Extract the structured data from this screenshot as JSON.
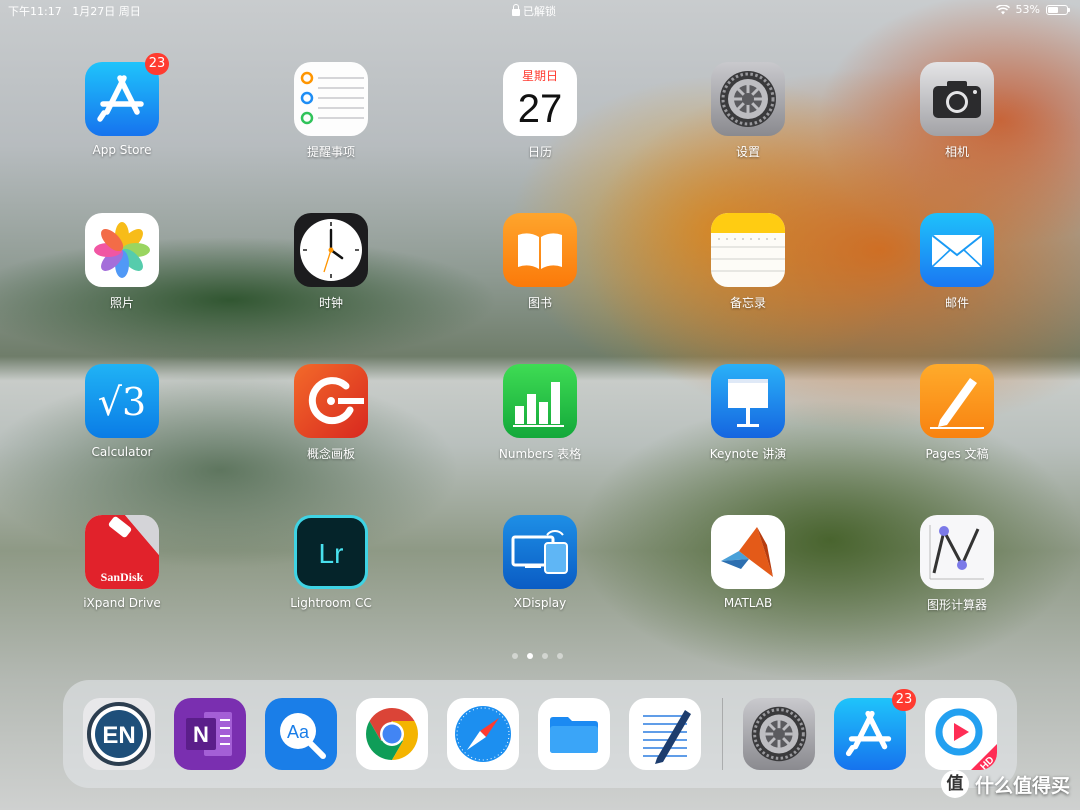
{
  "status_bar": {
    "time": "下午11:17",
    "date": "1月27日 周日",
    "lock_status": "已解锁",
    "battery_percent": "53%",
    "battery_level": 0.53
  },
  "apps": [
    {
      "label": "App Store",
      "icon": "app-store-icon",
      "badge": "23"
    },
    {
      "label": "提醒事项",
      "icon": "reminders-icon"
    },
    {
      "label": "日历",
      "icon": "calendar-icon",
      "weekday": "星期日",
      "day": "27"
    },
    {
      "label": "设置",
      "icon": "settings-icon"
    },
    {
      "label": "相机",
      "icon": "camera-icon"
    },
    {
      "label": "照片",
      "icon": "photos-icon"
    },
    {
      "label": "时钟",
      "icon": "clock-icon"
    },
    {
      "label": "图书",
      "icon": "books-icon"
    },
    {
      "label": "备忘录",
      "icon": "notes-icon"
    },
    {
      "label": "邮件",
      "icon": "mail-icon"
    },
    {
      "label": "Calculator",
      "icon": "calculator-icon",
      "glyph": "√3"
    },
    {
      "label": "概念画板",
      "icon": "concepts-icon"
    },
    {
      "label": "Numbers 表格",
      "icon": "numbers-icon"
    },
    {
      "label": "Keynote 讲演",
      "icon": "keynote-icon"
    },
    {
      "label": "Pages 文稿",
      "icon": "pages-icon"
    },
    {
      "label": "iXpand Drive",
      "icon": "ixpand-drive-icon",
      "glyph": "SanDisk"
    },
    {
      "label": "Lightroom CC",
      "icon": "lightroom-icon",
      "glyph": "Lr"
    },
    {
      "label": "XDisplay",
      "icon": "xdisplay-icon"
    },
    {
      "label": "MATLAB",
      "icon": "matlab-icon"
    },
    {
      "label": "图形计算器",
      "icon": "graphing-calculator-icon"
    }
  ],
  "page_dots": {
    "count": 4,
    "active_index": 1
  },
  "dock": [
    {
      "name": "evernote",
      "icon": "evernote-icon",
      "glyph": "EN"
    },
    {
      "name": "onenote",
      "icon": "onenote-icon",
      "glyph": "N"
    },
    {
      "name": "dictionary",
      "icon": "dictionary-icon",
      "glyph": "Aa"
    },
    {
      "name": "chrome",
      "icon": "chrome-icon"
    },
    {
      "name": "safari",
      "icon": "safari-icon"
    },
    {
      "name": "files",
      "icon": "files-icon"
    },
    {
      "name": "notability",
      "icon": "notability-icon"
    },
    {
      "name": "settings",
      "icon": "settings-icon"
    },
    {
      "name": "app-store",
      "icon": "app-store-icon",
      "badge": "23"
    },
    {
      "name": "youku-hd",
      "icon": "youku-hd-icon",
      "glyph": "HD"
    }
  ],
  "watermark": {
    "symbol": "值",
    "text": "什么值得买"
  }
}
